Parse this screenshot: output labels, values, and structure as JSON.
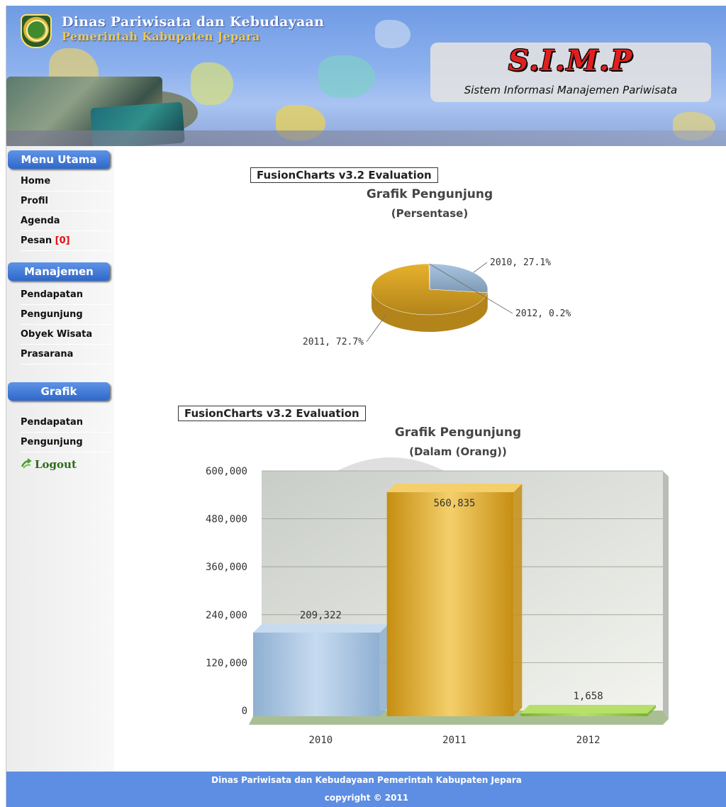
{
  "header": {
    "org_line1": "Dinas Pariwisata dan Kebudayaan",
    "org_line2": "Pemerintah Kabupaten Jepara",
    "app_title": "S.I.M.P",
    "app_subtitle": "Sistem Informasi Manajemen Pariwisata"
  },
  "sidebar": {
    "sections": [
      {
        "title": "Menu Utama",
        "items": [
          {
            "label": "Home"
          },
          {
            "label": "Profil"
          },
          {
            "label": "Agenda"
          },
          {
            "label": "Pesan ",
            "badge": "[0]"
          }
        ]
      },
      {
        "title": "Manajemen",
        "items": [
          {
            "label": "Pendapatan"
          },
          {
            "label": "Pengunjung"
          },
          {
            "label": "Obyek Wisata"
          },
          {
            "label": "Prasarana"
          }
        ]
      },
      {
        "title": "Grafik",
        "items": [
          {
            "label": "Pendapatan"
          },
          {
            "label": "Pengunjung"
          }
        ]
      }
    ],
    "logout_label": "Logout",
    "logout_icon": "logout-icon"
  },
  "pie_chart": {
    "eval_notice": "FusionCharts v3.2 Evaluation",
    "title": "Grafik Pengunjung",
    "subtitle": "(Persentase)"
  },
  "bar_chart": {
    "eval_notice": "FusionCharts v3.2 Evaluation",
    "title": "Grafik Pengunjung",
    "subtitle": "(Dalam (Orang))"
  },
  "footer": {
    "line1": "Dinas Pariwisata dan Kebudayaan Pemerintah Kabupaten Jepara",
    "line2": "copyright © 2011"
  },
  "colors": {
    "header_blue": "#6f9be4",
    "menu_blue": "#2f68c9",
    "footer_blue": "#5d8ee4",
    "slice_2010": "#a8c4e0",
    "slice_2011": "#e6b12c",
    "slice_2012": "#8cc63f"
  },
  "chart_data": [
    {
      "type": "pie",
      "title": "Grafik Pengunjung",
      "subtitle": "(Persentase)",
      "slices": [
        {
          "label": "2010",
          "percent": 27.1,
          "display": "2010, 27.1%"
        },
        {
          "label": "2011",
          "percent": 72.7,
          "display": "2011, 72.7%"
        },
        {
          "label": "2012",
          "percent": 0.2,
          "display": "2012, 0.2%"
        }
      ]
    },
    {
      "type": "bar",
      "title": "Grafik Pengunjung",
      "subtitle": "(Dalam (Orang))",
      "categories": [
        "2010",
        "2011",
        "2012"
      ],
      "values": [
        209322,
        560835,
        1658
      ],
      "value_labels": [
        "209,322",
        "560,835",
        "1,658"
      ],
      "ylim": [
        0,
        600000
      ],
      "yticks": [
        0,
        120000,
        240000,
        360000,
        480000,
        600000
      ],
      "ytick_labels": [
        "0",
        "120,000",
        "240,000",
        "360,000",
        "480,000",
        "600,000"
      ],
      "grid": true
    }
  ]
}
